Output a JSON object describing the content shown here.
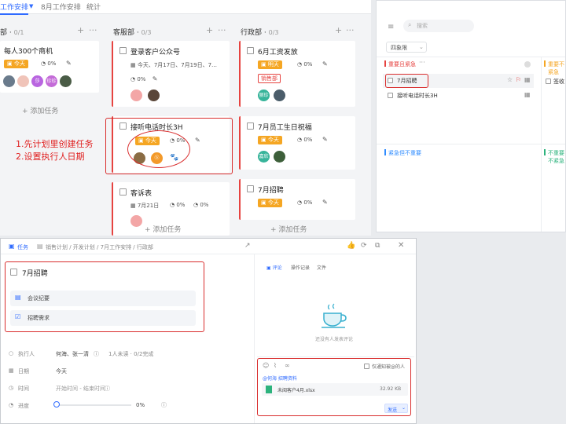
{
  "board": {
    "tabs": [
      {
        "label": "工作安排"
      },
      {
        "label": "8月工作安排"
      },
      {
        "label": "统计"
      }
    ],
    "columns": [
      {
        "name": "部",
        "count": "0/1",
        "cards": [
          {
            "title": "每人300个商机",
            "due_badge": "今天",
            "progress": "0%"
          }
        ],
        "add_label": "添加任务"
      },
      {
        "name": "客服部",
        "count": "0/3",
        "cards": [
          {
            "title": "登录客户公众号",
            "dates": "今天、7月17日、7月19日、7…",
            "progress": "0%"
          },
          {
            "title": "接听电话时长3H",
            "due_badge": "今天",
            "progress": "0%",
            "avatar2_text": "ⓑ"
          },
          {
            "title": "客诉表",
            "dates": "7月21日",
            "progress1": "0%",
            "progress2": "0%"
          }
        ],
        "add_label": "添加任务"
      },
      {
        "name": "行政部",
        "count": "0/3",
        "cards": [
          {
            "title": "6月工资发放",
            "due_badge": "明天",
            "progress": "0%",
            "tag": "销售部"
          },
          {
            "title": "7月员工生日祝福",
            "due_badge": "今天",
            "progress": "0%"
          },
          {
            "title": "7月招聘",
            "due_badge": "今天",
            "progress": "0%"
          }
        ],
        "add_label": "添加任务"
      }
    ],
    "avatars": {
      "col1": [
        "",
        "",
        "莎",
        "珍珍",
        ""
      ],
      "xingzheng1": [
        "丽珍",
        ""
      ],
      "xingzheng2": [
        "嘉欣",
        ""
      ]
    }
  },
  "annotation": {
    "line1": "1.先计划里创建任务",
    "line2": "2.设置执行人日期"
  },
  "quadrant": {
    "search_placeholder": "搜索",
    "view_select": "四象限",
    "q1_title": "重要且紧急",
    "q1_items": [
      "7月招聘",
      "接听电话时长3H"
    ],
    "q2_title": "重要不紧急",
    "q2_item": "签收",
    "q3_title": "紧急但不重要",
    "q4_title": "不重要不紧急",
    "colors": {
      "q1": "#e64340",
      "q2": "#f5a623",
      "q3": "#2f8cff",
      "q4": "#2db37d"
    }
  },
  "detail": {
    "breadcrumb": {
      "app": "任务",
      "path": "销售计划 / 开发计划 / 7月工作安排 / 行政部"
    },
    "task_title": "7月招聘",
    "attachments": [
      "会议纪要",
      "招聘需求"
    ],
    "fields": [
      {
        "label": "执行人",
        "value": "何海、张一清",
        "extra": "1人未读 · 0/2完成"
      },
      {
        "label": "日期",
        "value": "今天"
      },
      {
        "label": "时间",
        "value": "开始时间 - 结束时间"
      },
      {
        "label": "进度",
        "value": "0%"
      }
    ],
    "right_tabs": [
      "评论",
      "操作记录",
      "文件"
    ],
    "empty_text": "还没有人发表评论",
    "notify_label": "仅通知被@的人",
    "mentions": "@何海  招聘资料",
    "file_name": "未阅客户4月.xlsx",
    "file_size": "32.92 KB",
    "send_label": "发送"
  }
}
